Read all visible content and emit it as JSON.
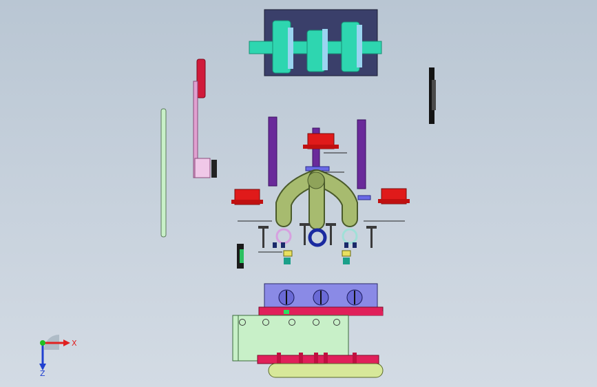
{
  "viewport": {
    "background_top": "#b9c6d3",
    "background_bottom": "#d3dbe4"
  },
  "triad": {
    "x_label": "X",
    "z_label": "Z",
    "x_color": "#e02020",
    "y_color": "#20c020",
    "z_color": "#2040d0"
  },
  "parts": {
    "crankcase_color": "#3a3f6a",
    "crankshaft_color": "#2ed6b0",
    "manifold_color": "#a7bb6f",
    "piston_color": "#e01a1a",
    "connecting_rod_color": "#6a2a9a",
    "cylinder_head_color": "#8a8ae6",
    "gasket_color": "#e0205a",
    "oil_pan_color": "#d7e89a",
    "timing_plate_color": "#c8f0c8"
  }
}
